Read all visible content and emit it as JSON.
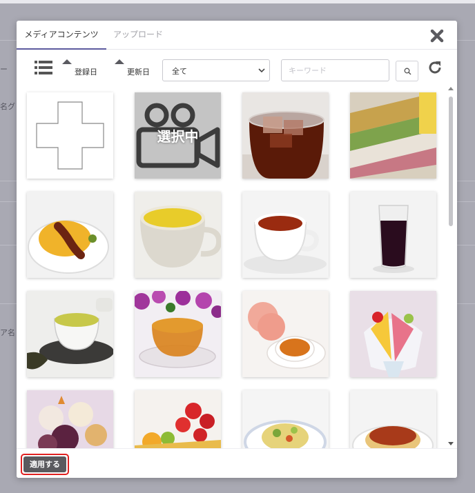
{
  "backdrop": {
    "side_texts": [
      "ー",
      "名グ",
      "ア名"
    ]
  },
  "tabs": [
    {
      "label": "メディアコンテンツ",
      "active": true
    },
    {
      "label": "アップロード",
      "active": false
    }
  ],
  "toolbar": {
    "sort_registered_label": "登録日",
    "sort_updated_label": "更新日",
    "filter_value": "全て",
    "search_placeholder": "キーワード"
  },
  "grid": {
    "selected_label": "選択中",
    "tiles": [
      {
        "kind": "add"
      },
      {
        "kind": "video",
        "selected": true
      },
      {
        "kind": "image",
        "subject": "iced-tea"
      },
      {
        "kind": "image",
        "subject": "sweets-buffet"
      },
      {
        "kind": "image",
        "subject": "omurice"
      },
      {
        "kind": "image",
        "subject": "corn-soup"
      },
      {
        "kind": "image",
        "subject": "minestrone"
      },
      {
        "kind": "image",
        "subject": "grape-juice"
      },
      {
        "kind": "image",
        "subject": "green-tea"
      },
      {
        "kind": "image",
        "subject": "herbal-tea"
      },
      {
        "kind": "image",
        "subject": "peach-tea"
      },
      {
        "kind": "image",
        "subject": "shaved-ice"
      },
      {
        "kind": "image",
        "subject": "parfait"
      },
      {
        "kind": "image",
        "subject": "fruit-tart"
      },
      {
        "kind": "image",
        "subject": "salad"
      },
      {
        "kind": "image",
        "subject": "spaghetti"
      }
    ]
  },
  "footer": {
    "apply_label": "適用する"
  },
  "colors": {
    "tab_active_underline": "#5c5a9e",
    "apply_button": "#5a5a5e",
    "apply_highlight": "#e02020"
  }
}
